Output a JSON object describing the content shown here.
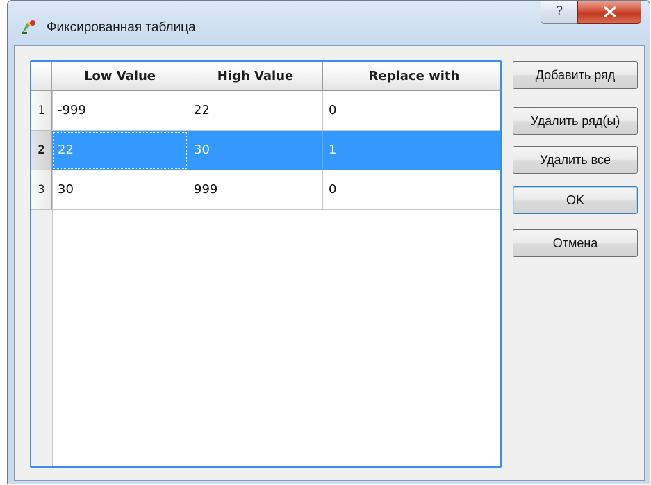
{
  "window": {
    "title": "Фиксированная таблица",
    "help_label": "?",
    "close_label": "X"
  },
  "table": {
    "columns": [
      "Low Value",
      "High Value",
      "Replace with"
    ],
    "rows": [
      {
        "num": "1",
        "cells": [
          "-999",
          "22",
          "0"
        ]
      },
      {
        "num": "2",
        "cells": [
          "22",
          "30",
          "1"
        ]
      },
      {
        "num": "3",
        "cells": [
          "30",
          "999",
          "0"
        ]
      }
    ],
    "selected_row": 2
  },
  "buttons": {
    "add_row": "Добавить ряд",
    "delete_rows": "Удалить ряд(ы)",
    "delete_all": "Удалить все",
    "ok": "OK",
    "cancel": "Отмена"
  },
  "colors": {
    "selection": "#3399ff",
    "frame_focus": "#3a8ee6",
    "close_button": "#c2381f"
  }
}
